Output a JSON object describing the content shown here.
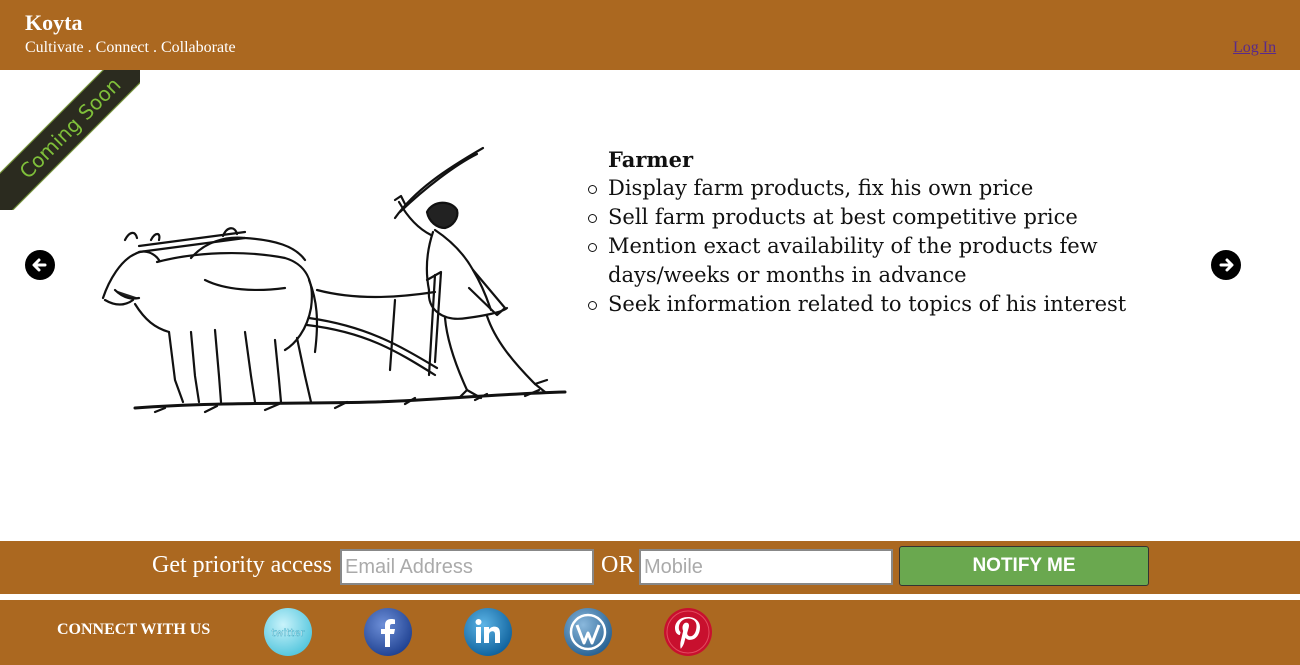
{
  "header": {
    "brand": "Koyta",
    "tagline": "Cultivate . Connect . Collaborate",
    "login_label": "Log In"
  },
  "ribbon": {
    "text": "Coming Soon"
  },
  "carousel": {
    "title": "Farmer",
    "items": [
      "Display farm products, fix his own price",
      "Sell farm products at best competitive price",
      "Mention exact availability of the products few days/weeks or months in advance",
      "Seek information related to topics of his interest"
    ],
    "prev_icon": "arrow-left-icon",
    "next_icon": "arrow-right-icon",
    "image": "farmer-plowing-with-oxen"
  },
  "access": {
    "label": "Get priority access",
    "email_placeholder": "Email Address",
    "or_label": "OR",
    "mobile_placeholder": "Mobile",
    "notify_label": "NOTIFY ME"
  },
  "footer": {
    "connect_label": "CONNECT WITH US",
    "social": [
      {
        "name": "twitter",
        "icon": "twitter-icon"
      },
      {
        "name": "facebook",
        "icon": "facebook-icon"
      },
      {
        "name": "linkedin",
        "icon": "linkedin-icon"
      },
      {
        "name": "wordpress",
        "icon": "wordpress-icon"
      },
      {
        "name": "pinterest",
        "icon": "pinterest-icon"
      }
    ],
    "twitter_text": "twitter"
  },
  "colors": {
    "brand_brown": "#ab6820",
    "notify_green": "#6aa84f",
    "ribbon_green": "#7fc03a"
  }
}
